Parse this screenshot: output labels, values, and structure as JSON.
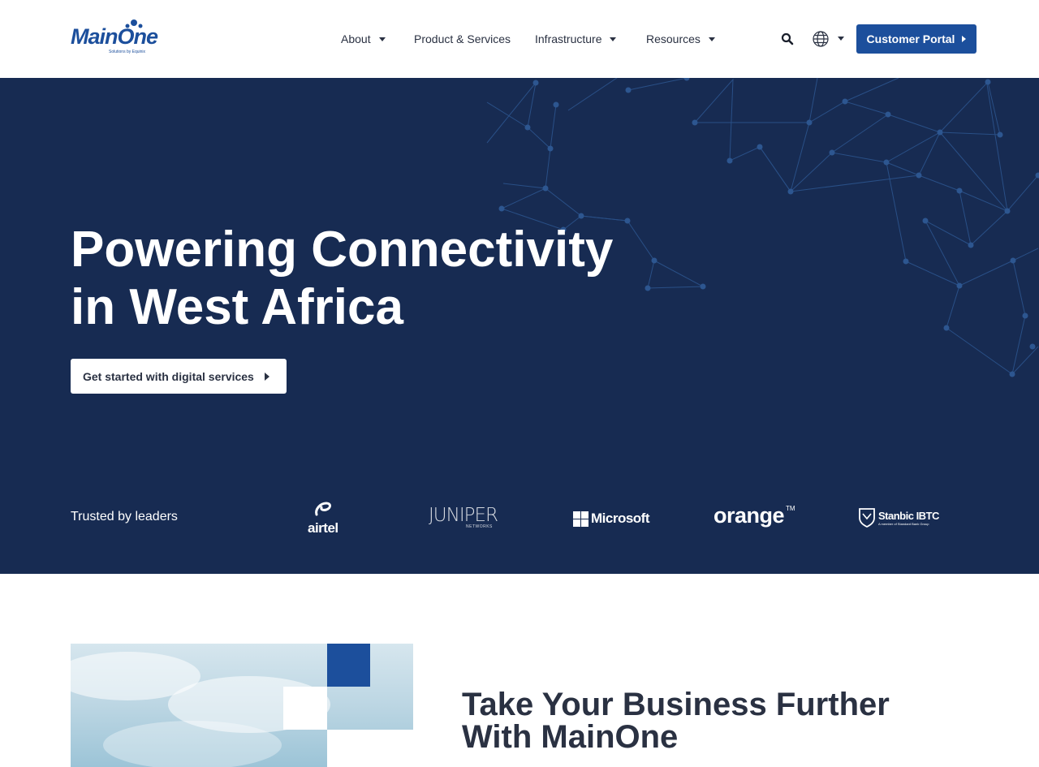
{
  "brand": {
    "name": "MainOne",
    "tagline": "Solutions by Equinix",
    "primary_color": "#1c4f9c",
    "hero_bg": "#172b52"
  },
  "nav": {
    "items": [
      {
        "label": "About",
        "has_dropdown": true
      },
      {
        "label": "Product & Services",
        "has_dropdown": false
      },
      {
        "label": "Infrastructure",
        "has_dropdown": true
      },
      {
        "label": "Resources",
        "has_dropdown": true
      }
    ],
    "search_icon": "search-icon",
    "language_icon": "globe-icon",
    "portal_label": "Customer Portal"
  },
  "hero": {
    "title_line1": "Powering Connectivity",
    "title_line2": "in West Africa",
    "cta_label": "Get started with digital services",
    "trusted_label": "Trusted by leaders",
    "partners": [
      {
        "name": "airtel"
      },
      {
        "name": "JUNIPER",
        "sub": "NETWORKS"
      },
      {
        "name": "Microsoft"
      },
      {
        "name": "orange",
        "mark": "TM"
      },
      {
        "name": "Stanbic IBTC",
        "sub": "A member of Standard Bank Group"
      }
    ]
  },
  "section": {
    "title_line1": "Take Your Business Further",
    "title_line2": "With MainOne"
  }
}
